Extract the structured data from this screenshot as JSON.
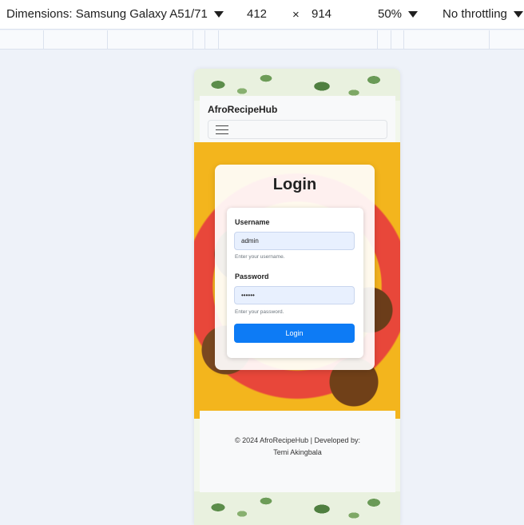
{
  "devtools": {
    "dimensions_label": "Dimensions: Samsung Galaxy A51/71",
    "width": "412",
    "times": "×",
    "height": "914",
    "zoom": "50%",
    "throttling": "No throttling"
  },
  "app": {
    "brand": "AfroRecipeHub"
  },
  "login": {
    "title": "Login",
    "username_label": "Username",
    "username_value": "admin",
    "username_hint": "Enter your username.",
    "password_label": "Password",
    "password_value": "••••••",
    "password_hint": "Enter your password.",
    "button_label": "Login"
  },
  "footer": {
    "line1": "© 2024 AfroRecipeHub | Developed by:",
    "line2": "Temi Akingbala"
  },
  "colors": {
    "primary": "#0d7bf5",
    "input_bg": "#e8f0fe",
    "page_bg": "#eef2f9"
  }
}
